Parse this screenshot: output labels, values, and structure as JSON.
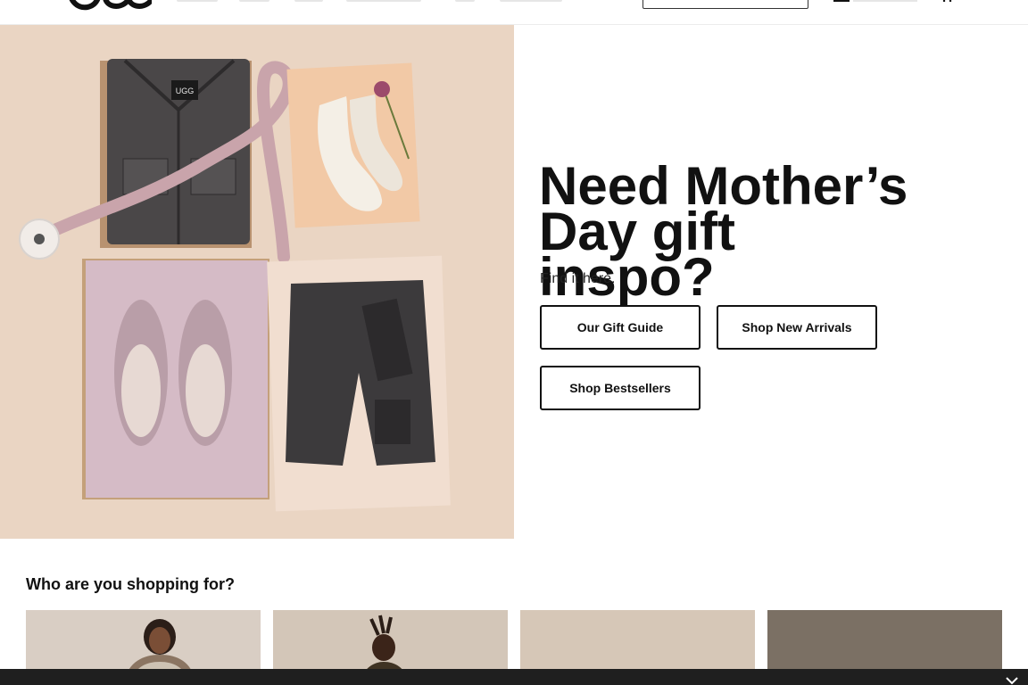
{
  "header": {
    "logo_text": "UGG",
    "search_placeholder": "",
    "icons": [
      "ugg-logo",
      "search-field",
      "account-icon",
      "bag-icon"
    ]
  },
  "hero": {
    "heading_line1": "Need Mother’s",
    "heading_line2": "Day gift inspo?",
    "subtext": "Find it here.",
    "buttons": {
      "gift_guide": "Our Gift Guide",
      "new_arrivals": "Shop New Arrivals",
      "bestsellers": "Shop Bestsellers"
    },
    "image_label": "UGG"
  },
  "shopping": {
    "title": "Who are you shopping for?"
  },
  "colors": {
    "text": "#111111",
    "hero_bg": "#ead6c5",
    "bottom_bar": "#1f1f1f"
  }
}
